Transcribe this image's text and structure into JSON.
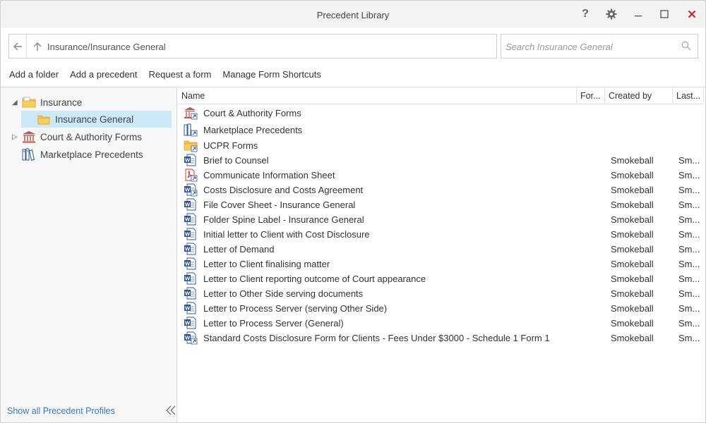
{
  "window": {
    "title": "Precedent Library",
    "help_label": "?"
  },
  "address": {
    "path": "Insurance/Insurance General"
  },
  "search": {
    "placeholder": "Search Insurance General"
  },
  "toolbar": {
    "add_folder": "Add a folder",
    "add_precedent": "Add a precedent",
    "request_form": "Request a form",
    "manage_shortcuts": "Manage Form Shortcuts"
  },
  "tree": {
    "items": [
      {
        "label": "Insurance",
        "icon": "folder-icon",
        "expanded": true
      },
      {
        "label": "Insurance General",
        "icon": "folder-icon",
        "selected": true
      },
      {
        "label": "Court & Authority Forms",
        "icon": "courthouse-icon",
        "expanded": false
      },
      {
        "label": "Marketplace Precedents",
        "icon": "books-icon"
      }
    ],
    "show_all": "Show all Precedent Profiles"
  },
  "columns": {
    "name": "Name",
    "form": "For...",
    "created_by": "Created by",
    "last": "Last..."
  },
  "rows": [
    {
      "name": "Court & Authority Forms",
      "icon": "courthouse-shortcut-icon",
      "created_by": "",
      "last": ""
    },
    {
      "name": "Marketplace Precedents",
      "icon": "books-shortcut-icon",
      "created_by": "",
      "last": ""
    },
    {
      "name": "UCPR Forms",
      "icon": "folder-shortcut-icon",
      "created_by": "",
      "last": ""
    },
    {
      "name": "Brief to Counsel",
      "icon": "word-doc-icon",
      "created_by": "Smokeball",
      "last": "Sm..."
    },
    {
      "name": "Communicate Information Sheet",
      "icon": "pdf-shortcut-icon",
      "created_by": "Smokeball",
      "last": "Sm..."
    },
    {
      "name": "Costs Disclosure and Costs Agreement",
      "icon": "word-shortcut-icon",
      "created_by": "Smokeball",
      "last": "Sm..."
    },
    {
      "name": "File Cover Sheet - Insurance General",
      "icon": "word-doc-icon",
      "created_by": "Smokeball",
      "last": "Sm..."
    },
    {
      "name": "Folder Spine Label - Insurance General",
      "icon": "word-doc-icon",
      "created_by": "Smokeball",
      "last": "Sm..."
    },
    {
      "name": "Initial letter to Client with Cost Disclosure",
      "icon": "word-doc-icon",
      "created_by": "Smokeball",
      "last": "Sm..."
    },
    {
      "name": "Letter of Demand",
      "icon": "word-doc-icon",
      "created_by": "Smokeball",
      "last": "Sm..."
    },
    {
      "name": "Letter to Client finalising matter",
      "icon": "word-doc-icon",
      "created_by": "Smokeball",
      "last": "Sm..."
    },
    {
      "name": "Letter to Client reporting outcome of Court appearance",
      "icon": "word-doc-icon",
      "created_by": "Smokeball",
      "last": "Sm..."
    },
    {
      "name": "Letter to Other Side serving documents",
      "icon": "word-doc-icon",
      "created_by": "Smokeball",
      "last": "Sm..."
    },
    {
      "name": "Letter to Process Server (serving Other Side)",
      "icon": "word-doc-icon",
      "created_by": "Smokeball",
      "last": "Sm..."
    },
    {
      "name": "Letter to Process Server (General)",
      "icon": "word-doc-icon",
      "created_by": "Smokeball",
      "last": "Sm..."
    },
    {
      "name": "Standard Costs Disclosure Form for Clients - Fees Under $3000 - Schedule 1 Form 1",
      "icon": "word-shortcut-icon",
      "created_by": "Smokeball",
      "last": "Sm..."
    }
  ],
  "colors": {
    "selection": "#cde8f7",
    "link": "#3a7ab8",
    "close": "#d41c1c",
    "word_blue": "#2b5797",
    "folder_yellow": "#f5c444",
    "court_red": "#c9504a"
  }
}
